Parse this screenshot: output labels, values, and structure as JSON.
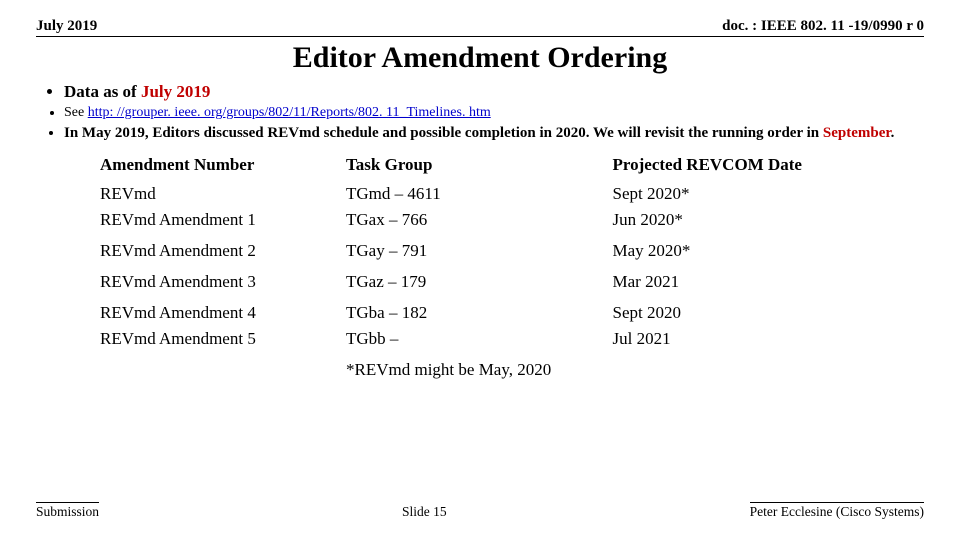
{
  "header": {
    "date": "July 2019",
    "docref": "doc. : IEEE 802. 11 -19/0990 r 0"
  },
  "title": "Editor Amendment Ordering",
  "bullets": {
    "data_as_of_prefix": "Data as of ",
    "data_as_of_accent": "July 2019",
    "see_prefix": "See ",
    "link_text": "http: //grouper. ieee. org/groups/802/11/Reports/802. 11_Timelines. htm",
    "link_href": "http://grouper.ieee.org/groups/802/11/Reports/802.11_Timelines.htm",
    "note_before": "In May 2019, Editors discussed REVmd schedule and possible completion in 2020. We will revisit the running order in ",
    "note_accent": "September",
    "note_after": "."
  },
  "table": {
    "headers": {
      "a": "Amendment Number",
      "b": "Task Group",
      "c": "Projected REVCOM Date"
    },
    "rows": [
      {
        "a": "REVmd",
        "b": "TGmd – 4611",
        "c": "Sept 2020*"
      },
      {
        "a": "REVmd Amendment 1",
        "b": "TGax – 766",
        "c": "Jun 2020*"
      },
      {
        "a": "REVmd Amendment 2",
        "b": "TGay – 791",
        "c": "May 2020*"
      },
      {
        "a": "REVmd Amendment 3",
        "b": "TGaz – 179",
        "c": "Mar 2021"
      },
      {
        "a": "REVmd Amendment 4",
        "b": "TGba – 182",
        "c": "Sept 2020"
      },
      {
        "a": "REVmd Amendment 5",
        "b": "TGbb –",
        "c": "Jul 2021"
      }
    ],
    "footnote": "*REVmd might be May, 2020"
  },
  "footer": {
    "left": "Submission",
    "center": "Slide 15",
    "right": "Peter Ecclesine (Cisco Systems)"
  }
}
